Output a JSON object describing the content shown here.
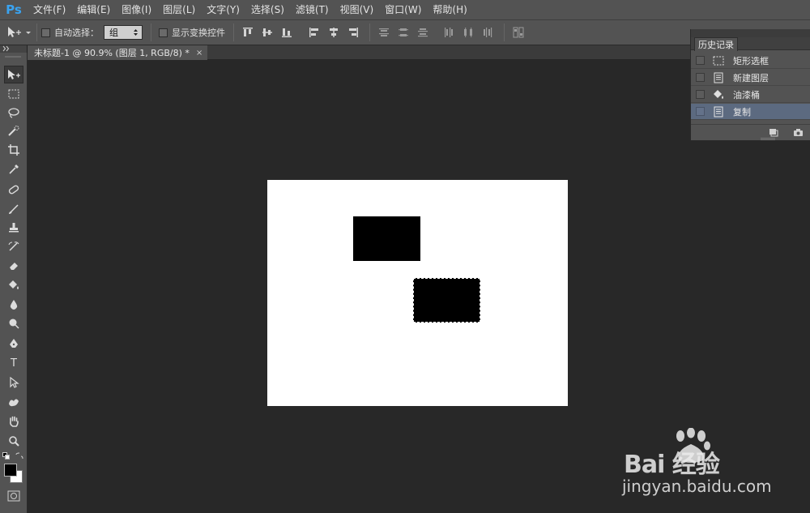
{
  "app": {
    "logo_text": "Ps"
  },
  "menu": [
    "文件(F)",
    "编辑(E)",
    "图像(I)",
    "图层(L)",
    "文字(Y)",
    "选择(S)",
    "滤镜(T)",
    "视图(V)",
    "窗口(W)",
    "帮助(H)"
  ],
  "options": {
    "auto_select_label": "自动选择：",
    "auto_select_value": "组",
    "show_transform_label": "显示变换控件"
  },
  "document": {
    "tab_title": "未标题-1 @ 90.9% (图层 1, RGB/8) *",
    "close_glyph": "×"
  },
  "history": {
    "panel_title": "历史记录",
    "items": [
      {
        "label": "矩形选框",
        "icon": "rect-marquee-icon",
        "selected": false
      },
      {
        "label": "新建图层",
        "icon": "layer-doc-icon",
        "selected": false
      },
      {
        "label": "油漆桶",
        "icon": "paint-bucket-icon",
        "selected": false
      },
      {
        "label": "复制",
        "icon": "layer-doc-icon",
        "selected": true
      }
    ]
  },
  "tools": [
    "move-tool",
    "marquee-tool",
    "lasso-tool",
    "quick-select-tool",
    "crop-tool",
    "eyedropper-tool",
    "healing-brush-tool",
    "brush-tool",
    "clone-stamp-tool",
    "history-brush-tool",
    "eraser-tool",
    "paint-bucket-tool",
    "blur-tool",
    "dodge-tool",
    "pen-tool",
    "type-tool",
    "path-select-tool",
    "shape-tool",
    "hand-tool",
    "zoom-tool"
  ],
  "tool_glyphs": {
    "type_tool": "T"
  },
  "colors": {
    "foreground": "#000000",
    "background": "#ffffff",
    "selected_row": "#5c6a80"
  },
  "watermark": {
    "logo_text": "Bai   经验",
    "url": "jingyan.baidu.com"
  }
}
